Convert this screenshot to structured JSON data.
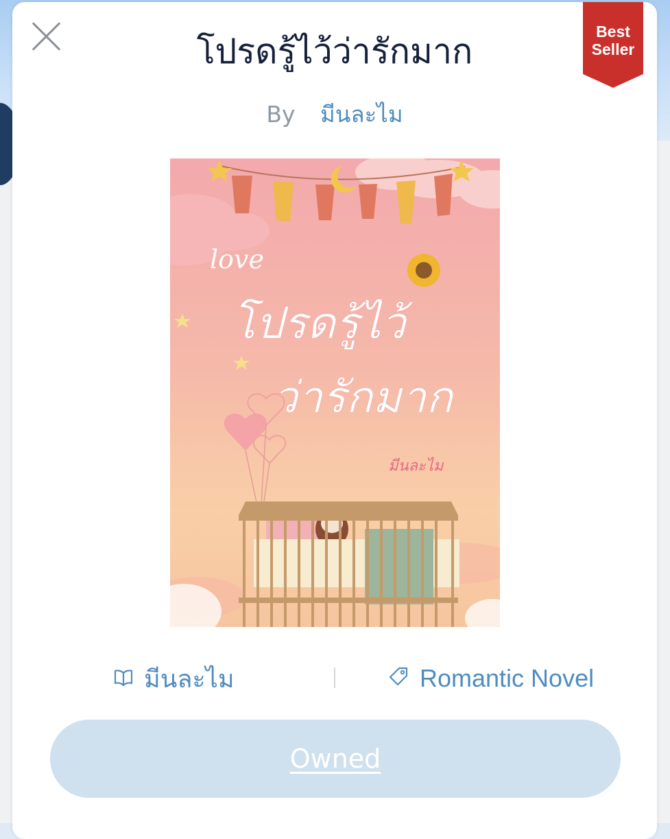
{
  "book": {
    "title": "โปรดรู้ไว้ว่ารักมาก",
    "by_label": "By",
    "author": "มีนละไม",
    "badge": "Best Seller",
    "genre": "Romantic Novel"
  },
  "cover_art": {
    "script_word": "love",
    "title_line1": "โปรดรู้ไว้",
    "title_line2": "ว่ารักมาก",
    "signature": "มีนละไม"
  },
  "icons": {
    "close": "close-icon",
    "author": "book-icon",
    "genre": "tag-icon"
  },
  "actions": {
    "owned_label": "Owned"
  },
  "colors": {
    "accent": "#4f8cc0",
    "badge": "#c9302b",
    "owned_button": "#cfe0ee"
  }
}
